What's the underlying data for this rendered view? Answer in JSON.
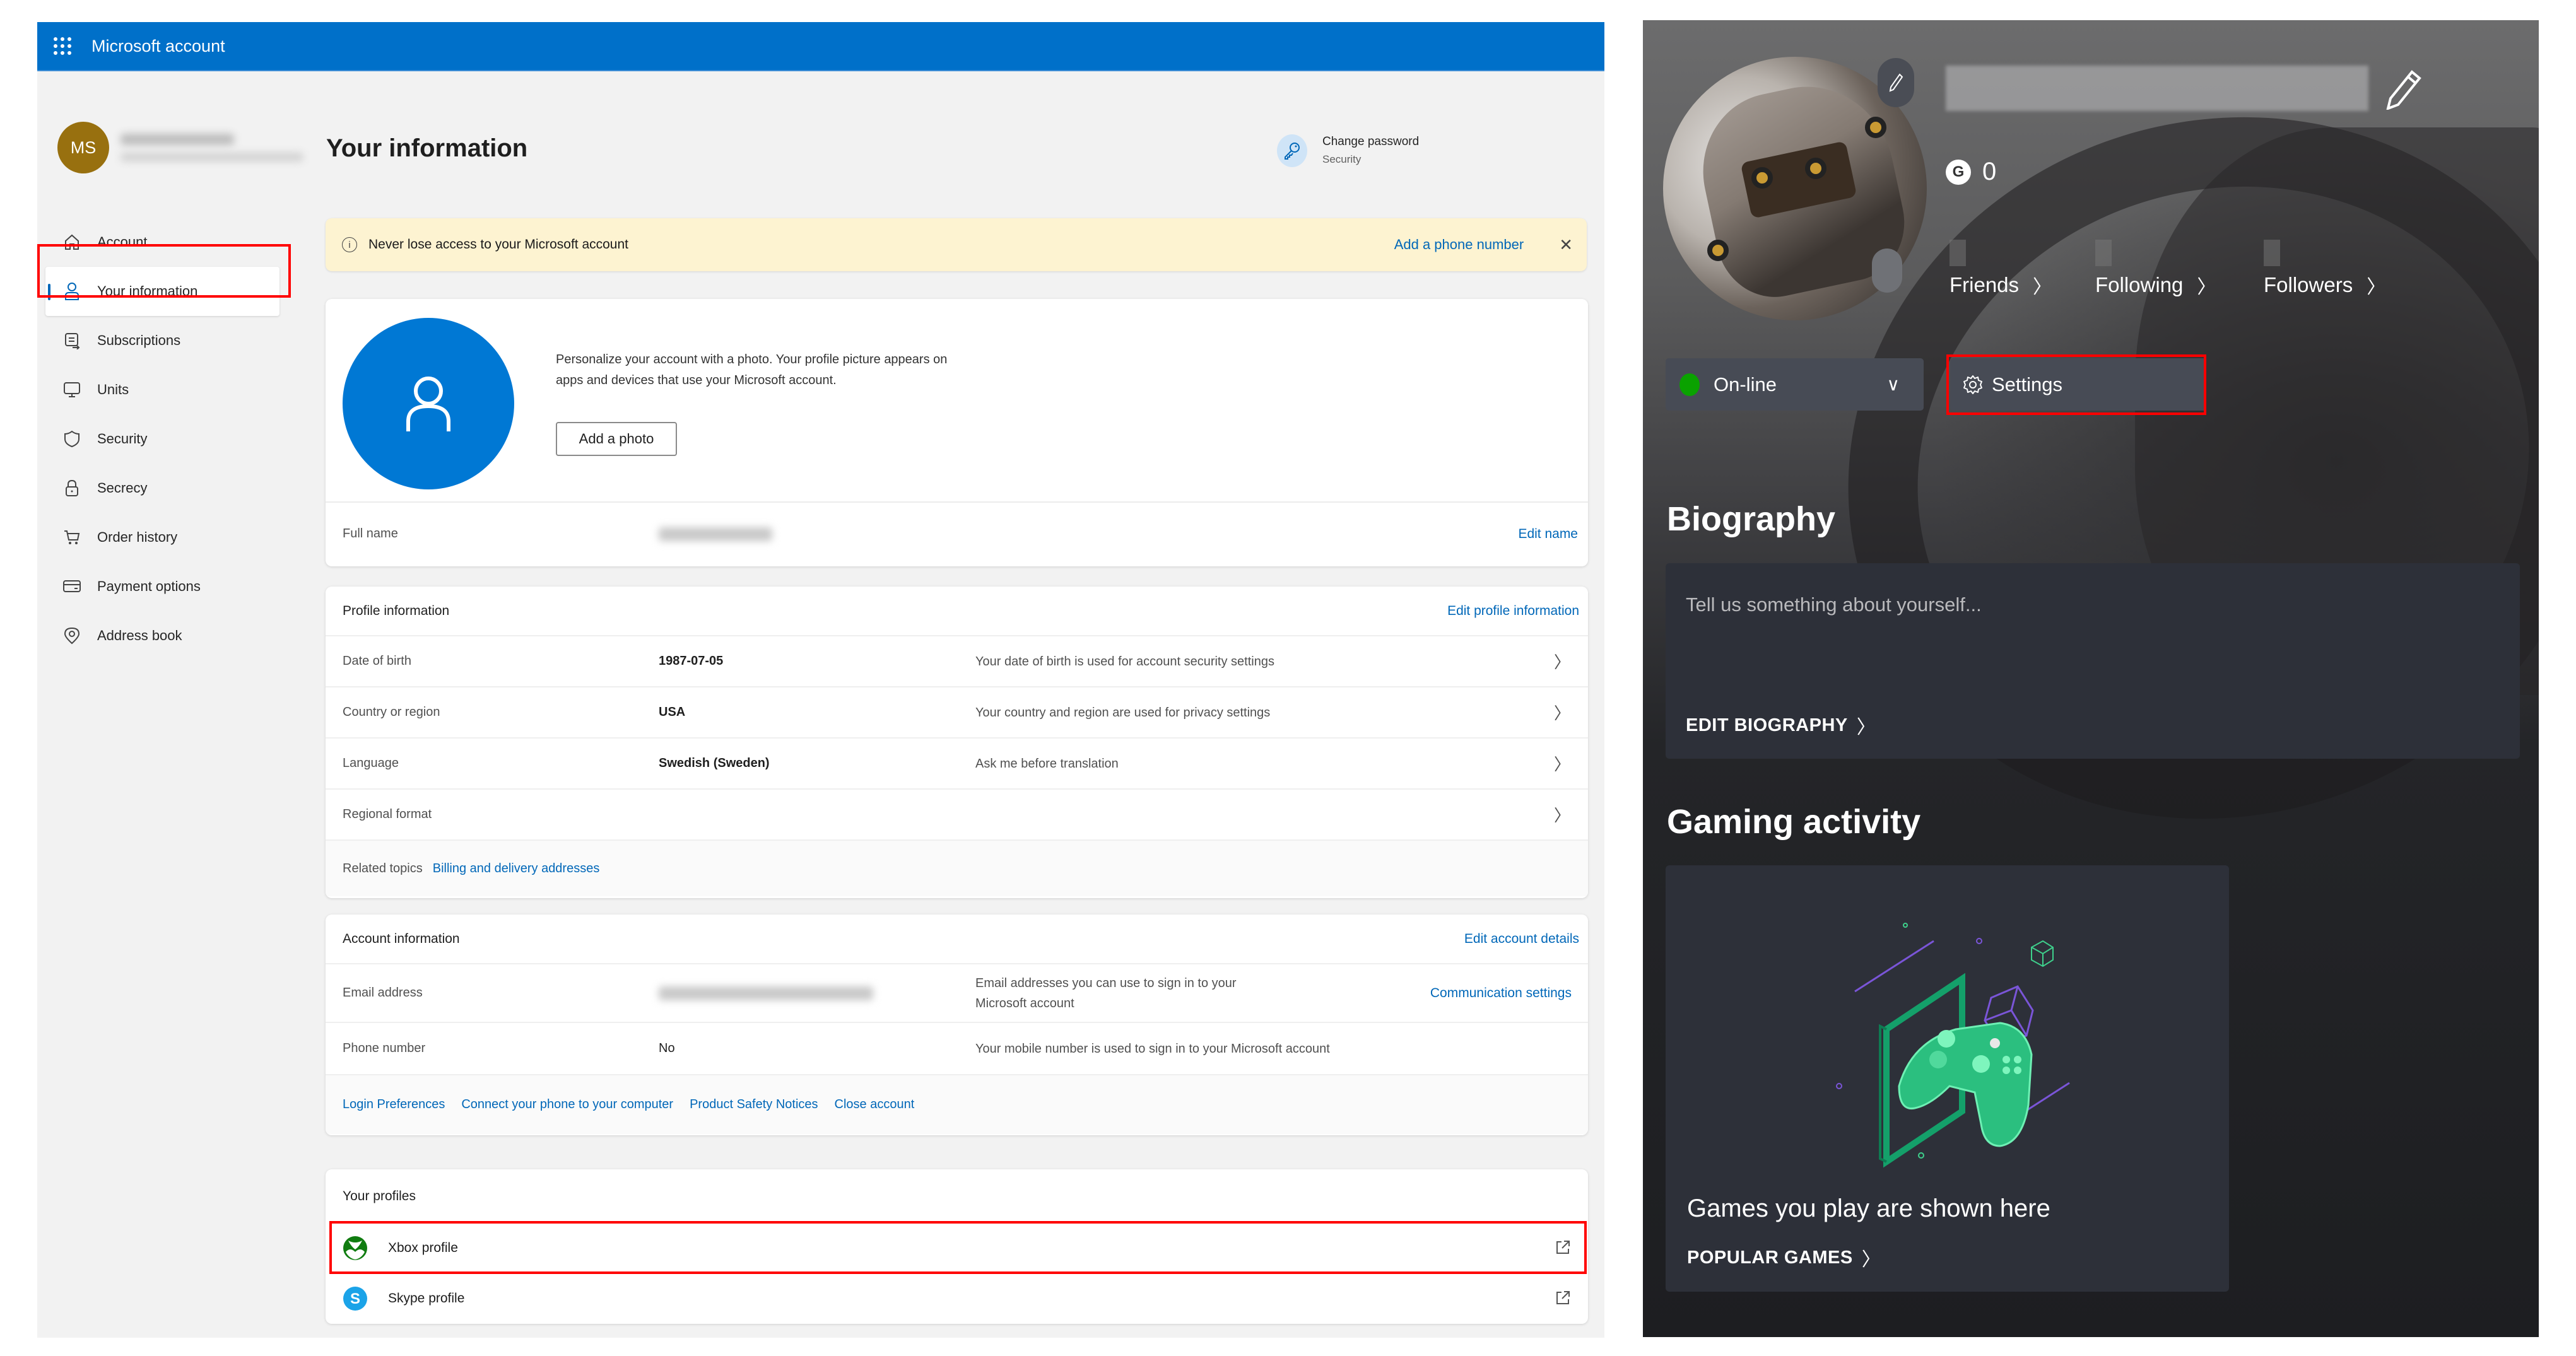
{
  "ms_account": {
    "app_title": "Microsoft account",
    "user": {
      "initials": "MS",
      "avatar_color": "#98700f"
    },
    "page_title": "Your information",
    "change_password": {
      "title": "Change password",
      "subtitle": "Security"
    },
    "sidebar": {
      "items": [
        {
          "label": "Account",
          "icon": "home-icon",
          "active": false
        },
        {
          "label": "Your information",
          "icon": "person-icon",
          "active": true
        },
        {
          "label": "Subscriptions",
          "icon": "subscriptions-icon",
          "active": false
        },
        {
          "label": "Units",
          "icon": "monitor-icon",
          "active": false
        },
        {
          "label": "Security",
          "icon": "shield-icon",
          "active": false
        },
        {
          "label": "Secrecy",
          "icon": "lock-icon",
          "active": false
        },
        {
          "label": "Order history",
          "icon": "cart-icon",
          "active": false
        },
        {
          "label": "Payment options",
          "icon": "credit-card-icon",
          "active": false
        },
        {
          "label": "Address book",
          "icon": "location-pin-icon",
          "active": false
        }
      ]
    },
    "banner": {
      "message": "Never lose access to your Microsoft account",
      "action": "Add a phone number",
      "close_icon": "close-icon"
    },
    "photo_card": {
      "description": "Personalize your account with a photo. Your profile picture appears on apps and devices that use your Microsoft account.",
      "add_photo_label": "Add a photo",
      "full_name_label": "Full name",
      "edit_name_label": "Edit name"
    },
    "profile_info": {
      "title": "Profile information",
      "edit_label": "Edit profile information",
      "rows": [
        {
          "label": "Date of birth",
          "value": "1987-07-05",
          "description": "Your date of birth is used for account security settings"
        },
        {
          "label": "Country or region",
          "value": "USA",
          "description": "Your country and region are used for privacy settings"
        },
        {
          "label": "Language",
          "value": "Swedish (Sweden)",
          "description": "Ask me before translation"
        },
        {
          "label": "Regional format",
          "value": "",
          "description": ""
        }
      ],
      "related_label": "Related topics",
      "related_link": "Billing and delivery addresses"
    },
    "account_info": {
      "title": "Account information",
      "edit_label": "Edit account details",
      "email_label": "Email address",
      "email_description": "Email addresses you can use to sign in to your Microsoft account",
      "email_link": "Communication settings",
      "phone_label": "Phone number",
      "phone_value": "No",
      "phone_description": "Your mobile number is used to sign in to your Microsoft account",
      "footer_links": [
        "Login Preferences",
        "Connect your phone to your computer",
        "Product Safety Notices",
        "Close account"
      ]
    },
    "profiles": {
      "title": "Your profiles",
      "items": [
        {
          "label": "Xbox profile",
          "icon": "xbox-logo-icon"
        },
        {
          "label": "Skype profile",
          "icon": "skype-logo-icon"
        }
      ]
    }
  },
  "xbox": {
    "gamerscore": "0",
    "gamerscore_badge": "G",
    "social": [
      {
        "label": "Friends"
      },
      {
        "label": "Following"
      },
      {
        "label": "Followers"
      }
    ],
    "presence": {
      "label": "On-line",
      "color": "#0aa200"
    },
    "settings_label": "Settings",
    "biography": {
      "title": "Biography",
      "placeholder": "Tell us something about yourself...",
      "edit_label": "EDIT BIOGRAPHY"
    },
    "gaming_activity": {
      "title": "Gaming activity",
      "empty_text": "Games you play are shown here",
      "cta_label": "POPULAR GAMES"
    }
  },
  "colors": {
    "ms_blue": "#0070c9",
    "link_blue": "#0067b8",
    "highlight_red": "#ff0000",
    "xbox_green": "#107c10"
  }
}
